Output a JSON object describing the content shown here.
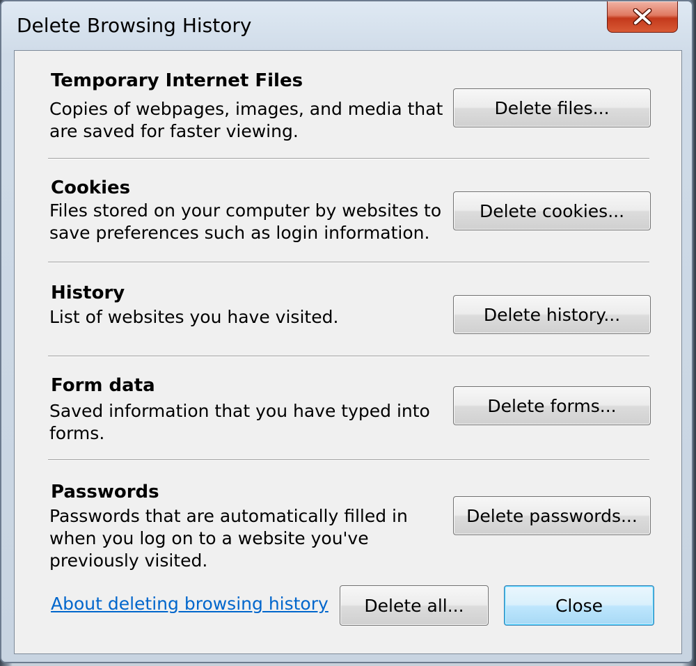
{
  "window": {
    "title": "Delete Browsing History",
    "close_glyph": "close-icon"
  },
  "sections": [
    {
      "heading": "Temporary Internet Files",
      "description": "Copies of webpages, images, and media that are saved for faster viewing.",
      "button": "Delete files..."
    },
    {
      "heading": "Cookies",
      "description": "Files stored on your computer by websites to save preferences such as login information.",
      "button": "Delete cookies..."
    },
    {
      "heading": "History",
      "description": "List of websites you have visited.",
      "button": "Delete history..."
    },
    {
      "heading": "Form data",
      "description": "Saved information that you have typed into forms.",
      "button": "Delete forms..."
    },
    {
      "heading": "Passwords",
      "description": "Passwords that are automatically filled in when you log on to a website you've previously visited.",
      "button": "Delete passwords..."
    }
  ],
  "footer": {
    "help_link": "About deleting browsing history",
    "delete_all": "Delete all...",
    "close": "Close"
  },
  "colors": {
    "link": "#0066cc",
    "dialog_background": "#f0f0f0",
    "close_button_accent": "#3c7fb1",
    "title_close_red": "#c4391c"
  }
}
